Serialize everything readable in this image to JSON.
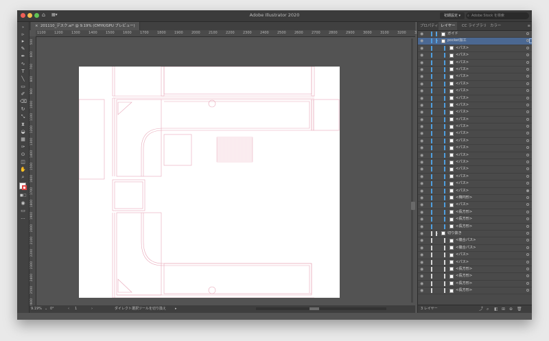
{
  "window": {
    "title": "Adobe Illustrator 2020",
    "workspace_label": "初期設定",
    "stock_placeholder": "Adobe Stock を検索"
  },
  "document": {
    "tab_title": "201110_デスク.ai* @ 9.19% (CMYK/GPU プレビュー)"
  },
  "ruler": {
    "ticks": [
      "1100",
      "1200",
      "1300",
      "1400",
      "1500",
      "1600",
      "1700",
      "1800",
      "1900",
      "2000",
      "2100",
      "2200",
      "2300",
      "2400",
      "2500",
      "2600",
      "2700",
      "2800",
      "2900",
      "3000",
      "3100",
      "3200",
      "3300"
    ],
    "vticks": [
      "500",
      "600",
      "700",
      "800",
      "900",
      "1000",
      "1100",
      "1200",
      "1300",
      "1400",
      "1500",
      "1600",
      "1700",
      "1800",
      "1900",
      "2000",
      "2100",
      "2200",
      "2300",
      "2400",
      "2500",
      "2600"
    ]
  },
  "status": {
    "zoom": "9.19%",
    "rotation": "0°",
    "artboard_num": "1",
    "hint": "ダイレクト選択ツールを切り換え"
  },
  "panel": {
    "tabs": [
      "プロパティ",
      "レイヤー",
      "CC ライブラリ",
      "カラー"
    ],
    "active_tab": "レイヤー",
    "layers": [
      {
        "label": "ガイド",
        "level": 0,
        "arrow": "›",
        "color": "#4f9fe0"
      },
      {
        "label": "pocket加工",
        "level": 0,
        "arrow": "⌄",
        "color": "#4f9fe0",
        "selected": true
      },
      {
        "label": "<パス>",
        "level": 1,
        "color": "#4f9fe0"
      },
      {
        "label": "<パス>",
        "level": 1,
        "color": "#4f9fe0"
      },
      {
        "label": "<パス>",
        "level": 1,
        "color": "#4f9fe0"
      },
      {
        "label": "<パス>",
        "level": 1,
        "color": "#4f9fe0"
      },
      {
        "label": "<パス>",
        "level": 1,
        "color": "#4f9fe0"
      },
      {
        "label": "<パス>",
        "level": 1,
        "color": "#4f9fe0"
      },
      {
        "label": "<パス>",
        "level": 1,
        "color": "#4f9fe0"
      },
      {
        "label": "<パス>",
        "level": 1,
        "color": "#4f9fe0"
      },
      {
        "label": "<パス>",
        "level": 1,
        "color": "#4f9fe0"
      },
      {
        "label": "<パス>",
        "level": 1,
        "color": "#4f9fe0"
      },
      {
        "label": "<パス>",
        "level": 1,
        "color": "#4f9fe0"
      },
      {
        "label": "<パス>",
        "level": 1,
        "color": "#4f9fe0"
      },
      {
        "label": "<パス>",
        "level": 1,
        "color": "#4f9fe0"
      },
      {
        "label": "<パス>",
        "level": 1,
        "color": "#4f9fe0"
      },
      {
        "label": "<パス>",
        "level": 1,
        "color": "#4f9fe0"
      },
      {
        "label": "<パス>",
        "level": 1,
        "color": "#4f9fe0"
      },
      {
        "label": "<パス>",
        "level": 1,
        "color": "#4f9fe0"
      },
      {
        "label": "<パス>",
        "level": 1,
        "color": "#4f9fe0"
      },
      {
        "label": "<パス>",
        "level": 1,
        "color": "#4f9fe0"
      },
      {
        "label": "<パス>",
        "level": 1,
        "color": "#4f9fe0"
      },
      {
        "label": "<パス>",
        "level": 1,
        "color": "#4f9fe0",
        "filled": true
      },
      {
        "label": "<楕円形>",
        "level": 1,
        "color": "#4f9fe0"
      },
      {
        "label": "<パス>",
        "level": 1,
        "color": "#4f9fe0"
      },
      {
        "label": "<長方形>",
        "level": 1,
        "color": "#4f9fe0"
      },
      {
        "label": "<長方形>",
        "level": 1,
        "color": "#4f9fe0"
      },
      {
        "label": "<長方形>",
        "level": 1,
        "color": "#4f9fe0"
      },
      {
        "label": "切り抜き",
        "level": 0,
        "arrow": "⌄",
        "color": "#d9d9d9"
      },
      {
        "label": "<複合パス>",
        "level": 1,
        "color": "#d9d9d9"
      },
      {
        "label": "<複合パス>",
        "level": 1,
        "color": "#d9d9d9"
      },
      {
        "label": "<パス>",
        "level": 1,
        "color": "#d9d9d9"
      },
      {
        "label": "<パス>",
        "level": 1,
        "color": "#d9d9d9"
      },
      {
        "label": "<長方形>",
        "level": 1,
        "color": "#d9d9d9"
      },
      {
        "label": "<長方形>",
        "level": 1,
        "color": "#d9d9d9"
      },
      {
        "label": "<長方形>",
        "level": 1,
        "color": "#d9d9d9"
      },
      {
        "label": "<長方形>",
        "level": 1,
        "color": "#d9d9d9"
      }
    ],
    "footer_label": "3 レイヤー"
  },
  "colors": {
    "accent": "#4b6892",
    "guide_line": "#e8a7b8"
  }
}
